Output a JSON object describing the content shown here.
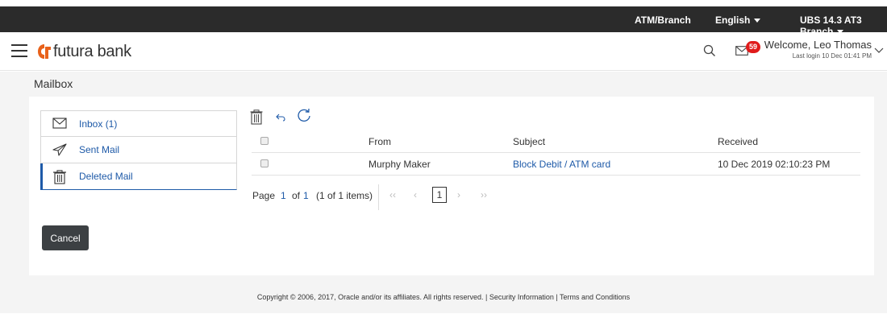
{
  "topbar": {
    "atm_branch": "ATM/Branch",
    "language": "English",
    "branch": "UBS 14.3 AT3 Branch"
  },
  "header": {
    "brand": "futura bank",
    "mail_count": "59",
    "welcome": "Welcome, Leo Thomas",
    "last_login": "Last login 10 Dec 01:41 PM"
  },
  "page": {
    "title": "Mailbox"
  },
  "sidebar": {
    "items": [
      {
        "label": "Inbox (1)",
        "icon": "envelope-icon"
      },
      {
        "label": "Sent Mail",
        "icon": "paper-plane-icon"
      },
      {
        "label": "Deleted Mail",
        "icon": "trash-icon"
      }
    ],
    "active": "Deleted Mail"
  },
  "table": {
    "headers": {
      "from": "From",
      "subject": "Subject",
      "received": "Received"
    },
    "rows": [
      {
        "from": "Murphy Maker",
        "subject": "Block Debit / ATM card",
        "received": "10 Dec 2019 02:10:23 PM"
      }
    ]
  },
  "pagination": {
    "page_label": "Page",
    "page": "1",
    "of_label": "of",
    "total_pages": "1",
    "items_text": "(1 of 1 items)",
    "current": "1"
  },
  "actions": {
    "cancel": "Cancel"
  },
  "footer": {
    "text": "Copyright © 2006, 2017, Oracle and/or its affiliates. All rights reserved. | Security Information | Terms and Conditions"
  },
  "colors": {
    "topbar": "#2b2b2b",
    "accent": "#1e5aa8",
    "badge": "#e01b1b",
    "logo": "#e8611a"
  }
}
